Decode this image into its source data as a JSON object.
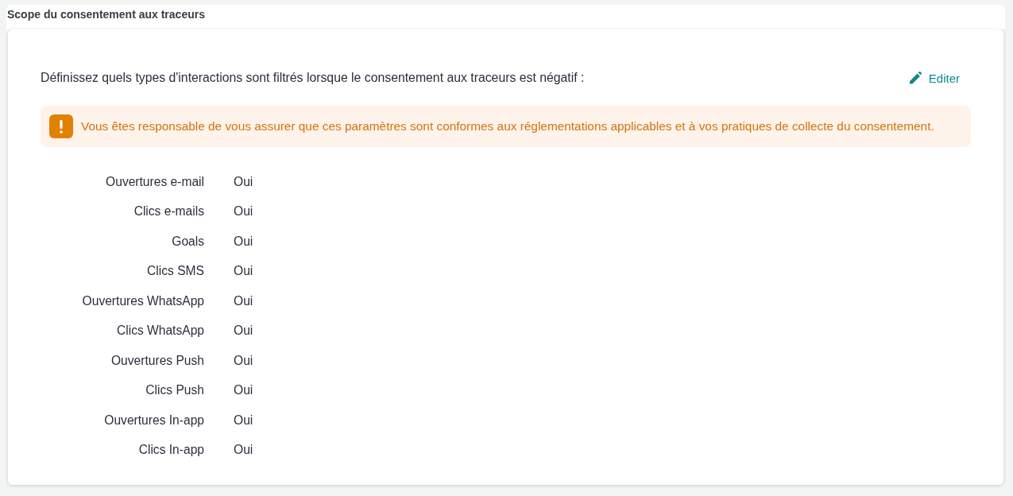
{
  "section": {
    "title": "Scope du consentement aux traceurs"
  },
  "description": "Définissez quels types d'interactions sont filtrés lorsque le consentement aux traceurs est négatif :",
  "edit_button": {
    "label": "Editer"
  },
  "alert": {
    "kind": "warning",
    "text": "Vous êtes responsable de vous assurer que ces paramètres sont conformes aux réglementations applicables et à vos pratiques de collecte du consentement."
  },
  "settings": [
    {
      "label": "Ouvertures e-mail",
      "value": "Oui"
    },
    {
      "label": "Clics e-mails",
      "value": "Oui"
    },
    {
      "label": "Goals",
      "value": "Oui"
    },
    {
      "label": "Clics SMS",
      "value": "Oui"
    },
    {
      "label": "Ouvertures WhatsApp",
      "value": "Oui"
    },
    {
      "label": "Clics WhatsApp",
      "value": "Oui"
    },
    {
      "label": "Ouvertures Push",
      "value": "Oui"
    },
    {
      "label": "Clics Push",
      "value": "Oui"
    },
    {
      "label": "Ouvertures In-app",
      "value": "Oui"
    },
    {
      "label": "Clics In-app",
      "value": "Oui"
    }
  ]
}
